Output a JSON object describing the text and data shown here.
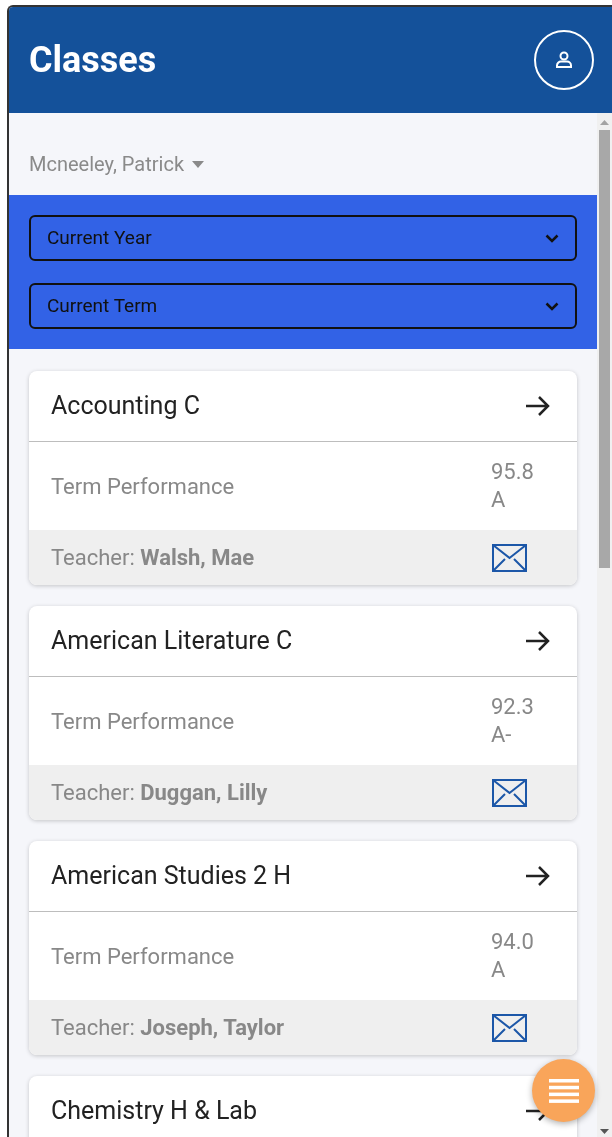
{
  "header": {
    "title": "Classes"
  },
  "student": {
    "name": "Mcneeley, Patrick"
  },
  "filters": [
    {
      "label": "Current Year"
    },
    {
      "label": "Current Term"
    }
  ],
  "classes": [
    {
      "name": "Accounting C",
      "performance_label": "Term Performance",
      "score": "95.8",
      "grade": "A",
      "teacher": "Teacher: **Walsh, Mae**"
    },
    {
      "name": "American Literature C",
      "performance_label": "Term Performance",
      "score": "92.3",
      "grade": "A-",
      "teacher": "Teacher: **Duggan, Lilly**"
    },
    {
      "name": "American Studies 2 H",
      "performance_label": "Term Performance",
      "score": "94.0",
      "grade": "A",
      "teacher": "Teacher: **Joseph, Taylor**"
    },
    {
      "name": "Chemistry H & Lab"
    }
  ]
}
